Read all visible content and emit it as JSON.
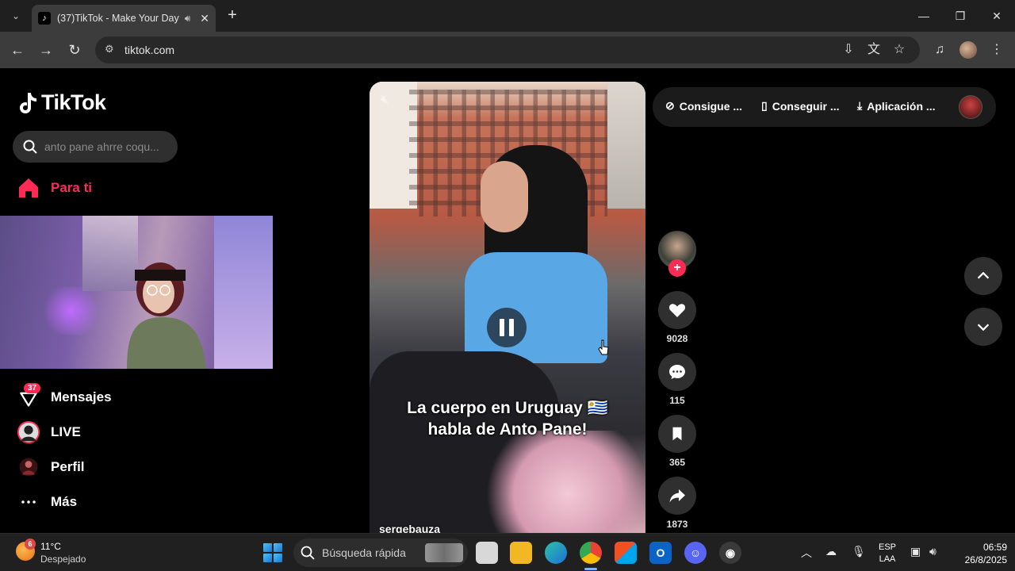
{
  "browser": {
    "tab_title": "(37)TikTok - Make Your Day",
    "url": "tiktok.com"
  },
  "sidebar": {
    "logo_text": "TikTok",
    "search_placeholder": "anto pane ahrre coqu...",
    "items": [
      {
        "label": "Para ti",
        "icon": "home-icon",
        "active": true
      },
      {
        "label": "Mensajes",
        "icon": "inbox-icon",
        "badge": "37"
      },
      {
        "label": "LIVE",
        "icon": "live-avatar-icon"
      },
      {
        "label": "Perfil",
        "icon": "profile-avatar-icon"
      },
      {
        "label": "Más",
        "icon": "more-icon"
      }
    ]
  },
  "video": {
    "caption_line1": "La cuerpo en Uruguay 🇺🇾",
    "caption_line2": "habla de Anto Pane!",
    "author": "sergebauza"
  },
  "actions": {
    "likes": "9028",
    "comments": "115",
    "saves": "365",
    "shares": "1873"
  },
  "top_bar": {
    "item1": "Consigue ...",
    "item2": "Conseguir ...",
    "item3": "Aplicación ..."
  },
  "taskbar": {
    "weather_badge": "6",
    "temperature": "11°C",
    "weather_desc": "Despejado",
    "search_text": "Búsqueda rápida",
    "lang_line1": "ESP",
    "lang_line2": "LAA",
    "time": "06:59",
    "date": "26/8/2025"
  },
  "colors": {
    "accent": "#fe2c55",
    "background": "#000000"
  }
}
